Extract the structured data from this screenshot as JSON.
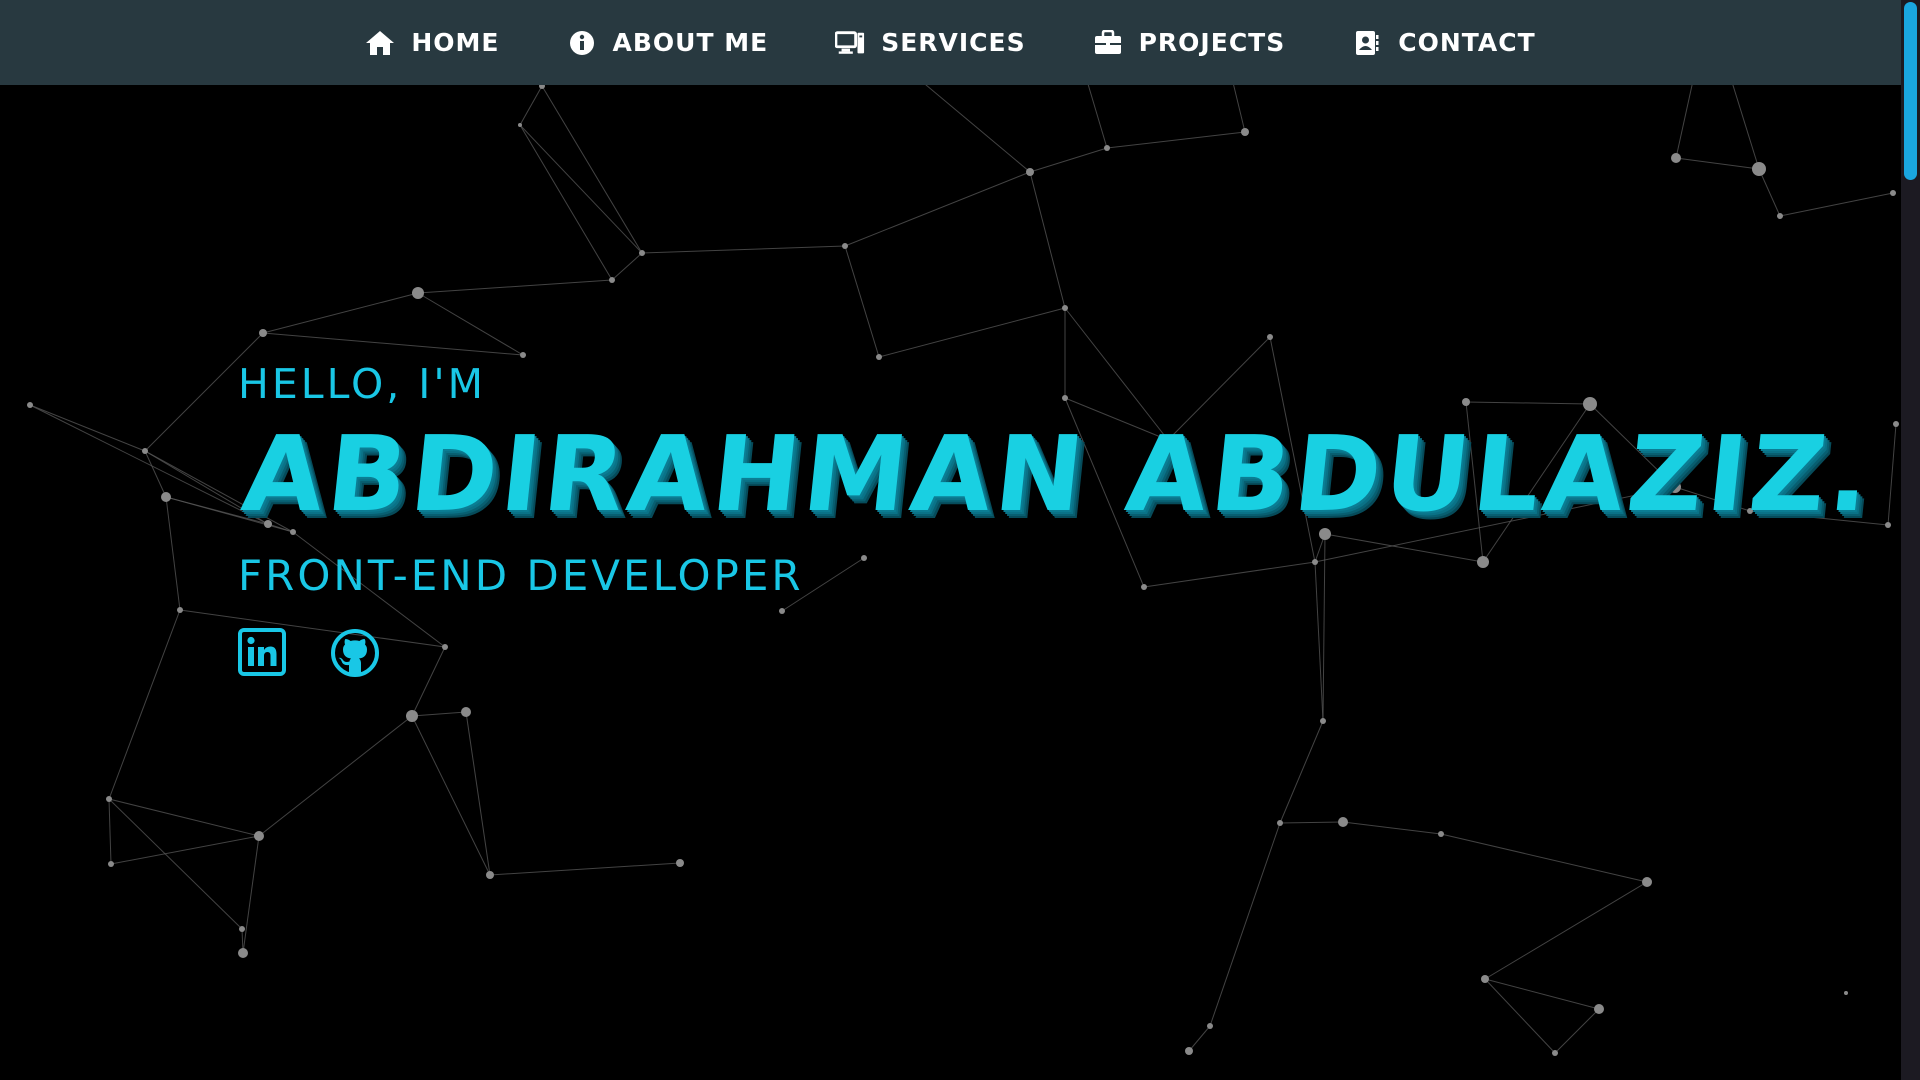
{
  "nav": {
    "items": [
      {
        "label": "Home",
        "icon": "home-icon"
      },
      {
        "label": "About Me",
        "icon": "info-icon"
      },
      {
        "label": "Services",
        "icon": "desktop-icon"
      },
      {
        "label": "Projects",
        "icon": "briefcase-icon"
      },
      {
        "label": "Contact",
        "icon": "contact-card-icon"
      }
    ]
  },
  "hero": {
    "greeting": "Hello, I'm",
    "name": "Abdirahman Abdulaziz.",
    "role": "Front-End Developer",
    "socials": [
      {
        "icon": "linkedin-icon"
      },
      {
        "icon": "github-icon"
      }
    ]
  },
  "colors": {
    "navbar_bg": "#283940",
    "page_bg": "#000000",
    "accent": "#19c7e6",
    "scrollbar_thumb": "#1aa6e0",
    "particle": "#8a8a8a"
  }
}
